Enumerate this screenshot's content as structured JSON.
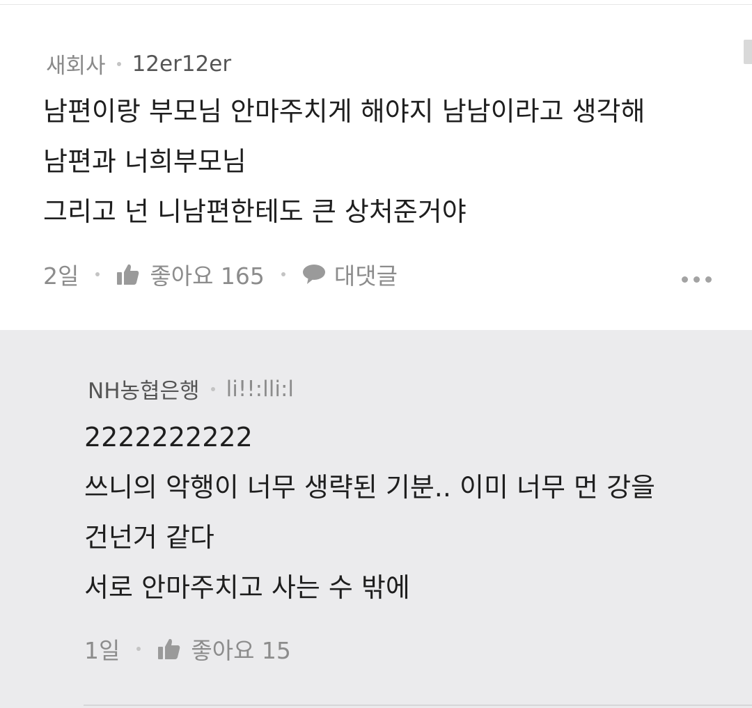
{
  "comment": {
    "source": "새회사",
    "nickname": "12er12er",
    "lines": [
      "남편이랑 부모님 안마주치게 해야지 남남이라고 생각해",
      "남편과 너희부모님",
      "그리고 넌 니남편한테도 큰 상처준거야"
    ],
    "time": "2일",
    "like_label": "좋아요 165",
    "reply_label": "대댓글",
    "icons": {
      "like": "thumbs-up-icon",
      "reply": "speech-bubble-icon",
      "more": "more-dots-icon"
    }
  },
  "reply": {
    "source": "NH농협은행",
    "nickname": "li!!:lli:l",
    "lines": [
      "2222222222",
      "쓰니의 악행이 너무 생략된 기분.. 이미 너무 먼 강을",
      "건넌거 같다",
      "서로 안마주치고 사는 수 밖에"
    ],
    "time": "1일",
    "like_label": "좋아요 15"
  },
  "colors": {
    "background": "#ffffff",
    "reply_background": "#ebebed",
    "text": "#1e1e1e",
    "meta_text": "#8a8a8a"
  }
}
